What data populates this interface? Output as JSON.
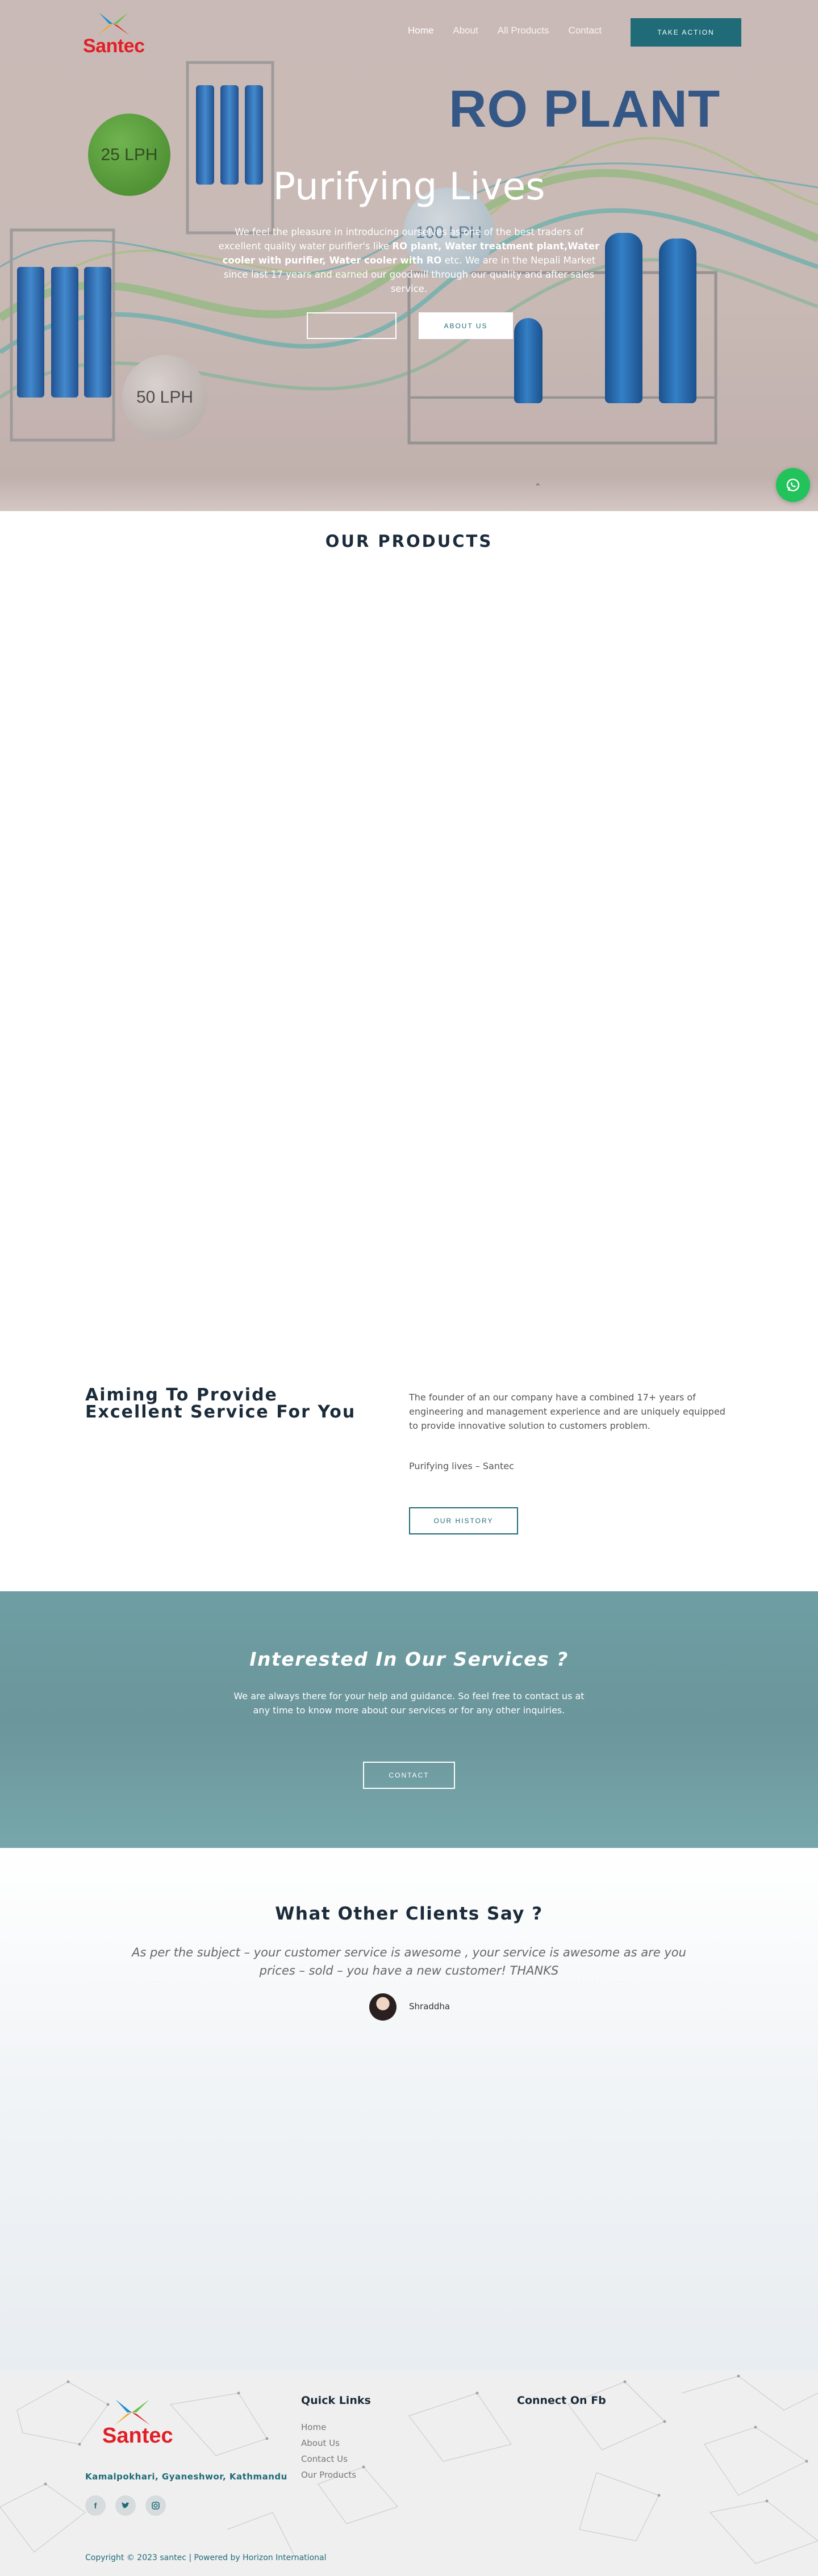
{
  "header": {
    "logo_text": "Santec",
    "nav": [
      "Home",
      "About",
      "All Products",
      "Contact"
    ],
    "cta_label": "TAKE ACTION"
  },
  "hero": {
    "banner_title": "RO PLANT",
    "badges": [
      "25 LPH",
      "100 LPH",
      "50 LPH"
    ],
    "title": "Purifying Lives",
    "desc_1": "We feel the pleasure in introducing ourselves as one of the best traders of excellent quality water purifier's like ",
    "desc_bold_1": "RO plant, Water treatment plant,Water cooler with purifier, Water cooler with RO",
    "desc_2": " etc. We are in the Nepali Market since last 17 years and earned our goodwill through our quality and after sales service.",
    "about_button": "ABOUT US"
  },
  "products": {
    "title": "OUR PRODUCTS"
  },
  "about": {
    "title": "Aiming To Provide Excellent Service For You",
    "text": "The founder of an our company have a combined 17+ years of engineering and management experience and are uniquely equipped to provide innovative solution to customers problem.",
    "tagline": "Purifying lives – Santec",
    "button": "OUR HISTORY"
  },
  "cta": {
    "title": "Interested In Our Services ?",
    "text": "We are always there for your help and guidance. So feel free to contact us at any time to know more about our services or for any other inquiries.",
    "button": "CONTACT"
  },
  "testimonials": {
    "title": "What Other Clients Say ?",
    "quote": "As per the subject – your customer service is awesome , your service is awesome as are you prices – sold – you have a new customer! THANKS",
    "author": "Shraddha"
  },
  "footer": {
    "logo_text": "Santec",
    "address": "Kamalpokhari, Gyaneshwor, Kathmandu",
    "social": [
      "facebook-icon",
      "twitter-icon",
      "instagram-icon"
    ],
    "quick_links_title": "Quick Links",
    "quick_links": [
      "Home",
      "About Us",
      "Contact Us",
      "Our Products"
    ],
    "fb_title": "Connect On Fb",
    "copyright": "Copyright © 2023 santec | Powered by Horizon International"
  },
  "colors": {
    "primary": "#1f6b78",
    "brand_red": "#e11f26",
    "whatsapp": "#22c35b"
  }
}
